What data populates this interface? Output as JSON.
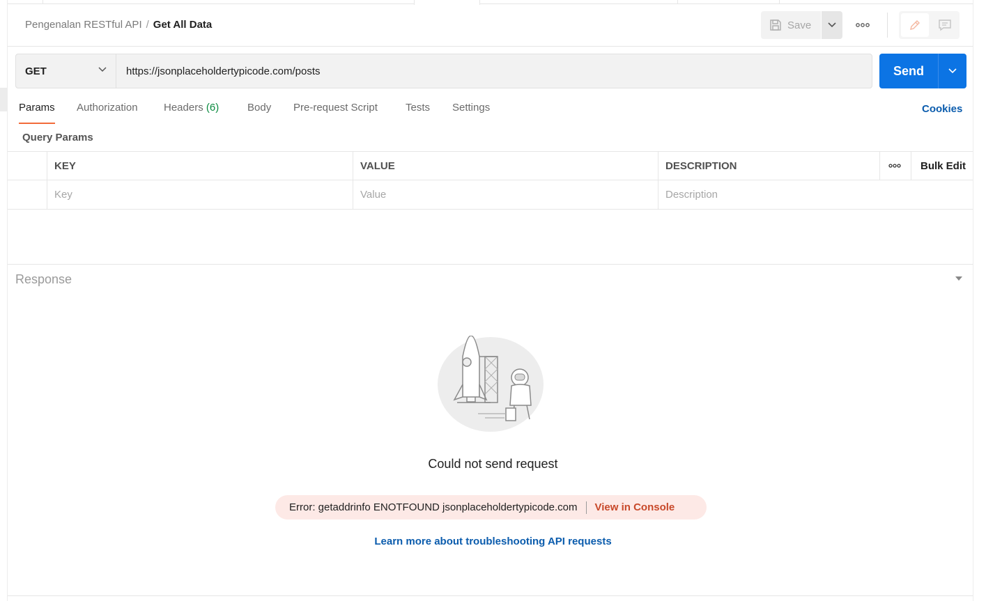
{
  "breadcrumb": {
    "parent": "Pengenalan RESTful API",
    "separator": "/",
    "current": "Get All Data"
  },
  "toolbar": {
    "save_label": "Save"
  },
  "request": {
    "method": "GET",
    "url": "https://jsonplaceholdertypicode.com/posts",
    "send_label": "Send"
  },
  "tabs": [
    {
      "label": "Params",
      "active": true
    },
    {
      "label": "Authorization"
    },
    {
      "label": "Headers",
      "count": "(6)"
    },
    {
      "label": "Body"
    },
    {
      "label": "Pre-request Script"
    },
    {
      "label": "Tests"
    },
    {
      "label": "Settings"
    }
  ],
  "cookies_label": "Cookies",
  "query_params": {
    "title": "Query Params",
    "columns": {
      "key": "KEY",
      "value": "VALUE",
      "description": "DESCRIPTION"
    },
    "bulk_edit_label": "Bulk Edit",
    "placeholders": {
      "key": "Key",
      "value": "Value",
      "description": "Description"
    }
  },
  "response": {
    "title": "Response",
    "error_title": "Could not send request",
    "error_message": "Error: getaddrinfo ENOTFOUND jsonplaceholdertypicode.com",
    "view_console_label": "View in Console",
    "learn_more_label": "Learn more about troubleshooting API requests"
  },
  "colors": {
    "send_button": "#0c74e4",
    "active_tab_underline": "#f26b3a",
    "link": "#0b5cad",
    "error_pill_bg": "#fde9e6",
    "error_link": "#c8492a",
    "header_count": "#0a8a3f"
  },
  "icons": [
    "save-icon",
    "chevron-down-icon",
    "more-horizontal-icon",
    "pencil-icon",
    "comment-icon",
    "caret-down-icon",
    "rocket-astronaut-illustration"
  ]
}
